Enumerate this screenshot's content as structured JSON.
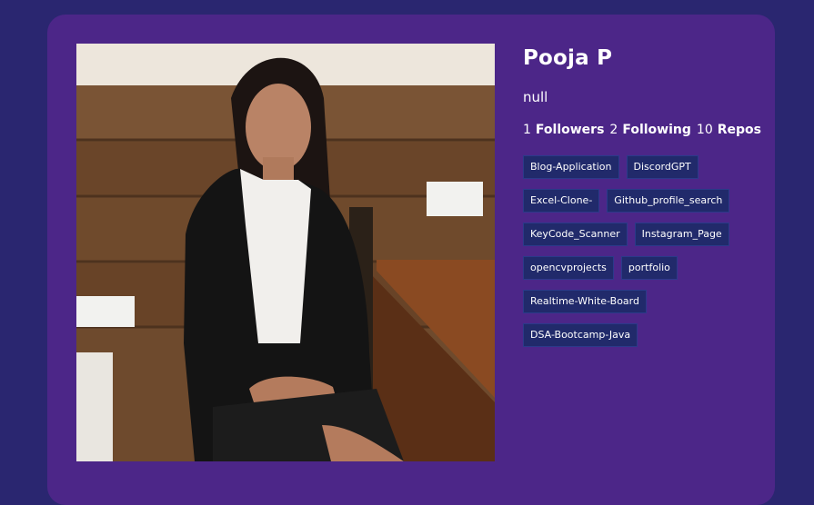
{
  "profile": {
    "name": "Pooja P",
    "bio": "null",
    "followers_count": "1",
    "followers_label": "Followers",
    "following_count": "2",
    "following_label": "Following",
    "repos_count": "10",
    "repos_label": "Repos"
  },
  "repos": [
    "Blog-Application",
    "DiscordGPT",
    "Excel-Clone-",
    "Github_profile_search",
    "KeyCode_Scanner",
    "Instagram_Page",
    "opencvprojects",
    "portfolio",
    "Realtime-White-Board",
    "DSA-Bootcamp-Java"
  ],
  "colors": {
    "page_bg": "#2a2670",
    "card_bg": "#4c2688",
    "repo_tag_bg": "#212a6b"
  }
}
